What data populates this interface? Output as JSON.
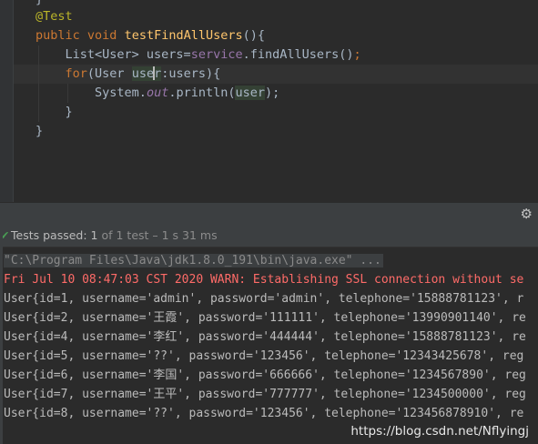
{
  "editor": {
    "prev_brace": "}",
    "annotation": "@Test",
    "method_kw1": "public",
    "method_kw2": "void",
    "method_name": "testFindAllUsers",
    "method_rest": "(){",
    "list_type": "List<User> users=",
    "list_field": "service",
    "list_call": ".findAllUsers()",
    "list_end": ";",
    "for_kw": "for",
    "for_open": "(User ",
    "for_var_a": "use",
    "for_var_b": "r",
    "for_rest": ":users){",
    "sys_a": "System.",
    "sys_out": "out",
    "sys_b": ".println(",
    "sys_arg": "user",
    "sys_c": ");",
    "close_inner": "}",
    "close_outer": "}"
  },
  "toolbar": {
    "settings_icon": "gear-icon",
    "settings_glyph": "⚙"
  },
  "status": {
    "check_glyph": "✔",
    "label": "Tests passed:",
    "count": "1",
    "detail": "of 1 test – 1 s 31 ms",
    "pass_color": "#499c54"
  },
  "console": {
    "command": "\"C:\\Program Files\\Java\\jdk1.8.0_191\\bin\\java.exe\" ...",
    "warn": "Fri Jul 10 08:47:03 CST 2020 WARN: Establishing SSL connection without se",
    "rows": [
      "User{id=1, username='admin', password='admin', telephone='15888781123', r",
      "User{id=2, username='王霞', password='111111', telephone='13990901140', re",
      "User{id=4, username='李红', password='444444', telephone='15888781123', re",
      "User{id=5, username='??', password='123456', telephone='12343425678', reg",
      "User{id=6, username='李国', password='666666', telephone='1234567890', reg",
      "User{id=7, username='王平', password='777777', telephone='1234500000', reg",
      "User{id=8, username='??', password='123456', telephone='123456878910', re"
    ],
    "watermark": "https://blog.csdn.net/Nflyingj"
  }
}
